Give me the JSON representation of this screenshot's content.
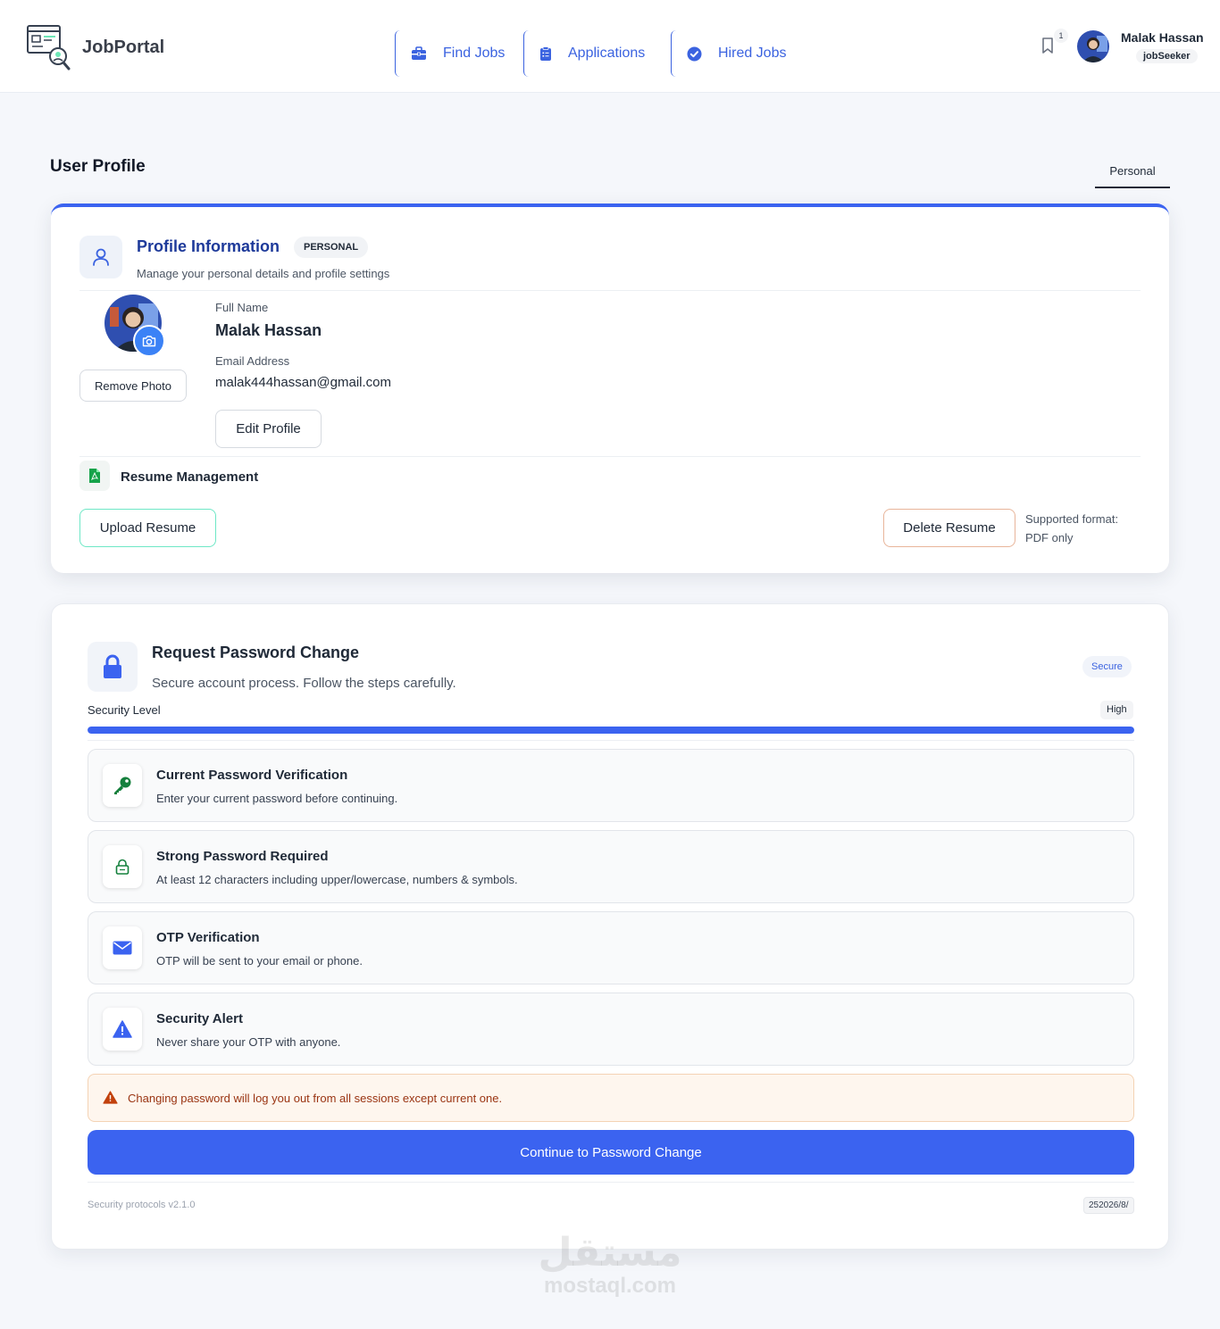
{
  "app": {
    "name": "JobPortal"
  },
  "nav": [
    {
      "label": "Find Jobs",
      "icon": "briefcase-icon"
    },
    {
      "label": "Applications",
      "icon": "clipboard-icon"
    },
    {
      "label": "Hired Jobs",
      "icon": "check-circle-icon"
    }
  ],
  "header": {
    "notifications": "1",
    "user_name": "Malak Hassan",
    "user_role": "jobSeeker"
  },
  "page": {
    "title": "User Profile",
    "tab": "Personal"
  },
  "profile": {
    "title": "Profile Information",
    "badge": "PERSONAL",
    "subtitle": "Manage your personal details and profile settings",
    "remove_photo": "Remove Photo",
    "full_name_label": "Full Name",
    "full_name": "Malak Hassan",
    "email_label": "Email Address",
    "email": "malak444hassan@gmail.com",
    "edit_button": "Edit Profile"
  },
  "resume": {
    "title": "Resume Management",
    "upload_button": "Upload Resume",
    "delete_button": "Delete Resume",
    "format_line1": "Supported format:",
    "format_line2": "PDF only"
  },
  "password": {
    "title": "Request Password Change",
    "subtitle": "Secure account process. Follow the steps carefully.",
    "badge": "Secure",
    "security_label": "Security Level",
    "security_value": "High",
    "security_level": 1.0,
    "steps": [
      {
        "title": "Current Password Verification",
        "desc": "Enter your current password before continuing.",
        "icon": "key-icon"
      },
      {
        "title": "Strong Password Required",
        "desc": "At least 12 characters including upper/lowercase, numbers & symbols.",
        "icon": "lock-icon"
      },
      {
        "title": "OTP Verification",
        "desc": "OTP will be sent to your email or phone.",
        "icon": "envelope-icon"
      },
      {
        "title": "Security Alert",
        "desc": "Never share your OTP with anyone.",
        "icon": "warning-icon"
      }
    ],
    "warning": "Changing password will log you out from all sessions except current one.",
    "continue_button": "Continue to Password Change",
    "footer_version": "Security protocols v2.1.0",
    "footer_date": "252026/8/"
  },
  "watermark": {
    "arabic": "مستقل",
    "latin": "mostaql.com"
  },
  "colors": {
    "primary": "#3b63f0",
    "nav": "#3b63e0",
    "title_blue": "#1e3a9a",
    "warning_bg": "#fef6ee",
    "warning_text": "#9a3412"
  }
}
